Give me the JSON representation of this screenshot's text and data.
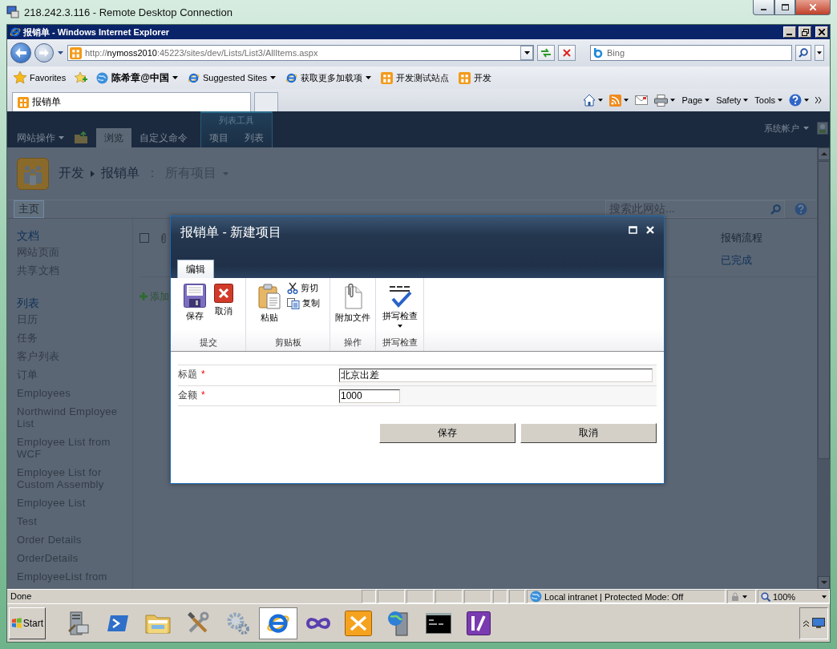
{
  "rdp_window": {
    "title": "218.242.3.116 - Remote Desktop Connection"
  },
  "browser": {
    "title": "报销单 - Windows Internet Explorer",
    "address": {
      "scheme": "http://",
      "host": "nymoss2010",
      "path": ":45223/sites/dev/Lists/List3/AllItems.aspx"
    },
    "search_placeholder": "Bing",
    "favorites_label": "Favorites",
    "favorites": [
      {
        "label": "陈希章@中国",
        "kind": "globe",
        "dropdown": true,
        "emphasized": true
      },
      {
        "label": "Suggested Sites",
        "kind": "ie",
        "dropdown": true,
        "emphasized": false
      },
      {
        "label": "获取更多加载项",
        "kind": "ie",
        "dropdown": true,
        "emphasized": false
      },
      {
        "label": "开发测试站点",
        "kind": "site",
        "dropdown": false,
        "emphasized": false
      },
      {
        "label": "开发",
        "kind": "site",
        "dropdown": false,
        "emphasized": false
      }
    ],
    "tabs": [
      {
        "label": "报销单",
        "selected": true
      }
    ],
    "commands": [
      {
        "kind": "home",
        "dropdown": true
      },
      {
        "kind": "feed",
        "dropdown": true
      },
      {
        "kind": "mail",
        "dropdown": false
      },
      {
        "kind": "print",
        "dropdown": true
      },
      {
        "label": "Page",
        "dropdown": true
      },
      {
        "label": "Safety",
        "dropdown": true
      },
      {
        "label": "Tools",
        "dropdown": true
      },
      {
        "kind": "help",
        "dropdown": true
      }
    ]
  },
  "sharepoint": {
    "top_bar": {
      "site_actions": "网站操作",
      "tabs": [
        {
          "label": "浏览",
          "selected": true
        },
        {
          "label": "自定义命令",
          "selected": false
        }
      ],
      "context_group": {
        "title": "列表工具",
        "tabs": [
          {
            "label": "项目",
            "selected": false
          },
          {
            "label": "列表",
            "selected": false
          }
        ]
      },
      "user": "系统帐户"
    },
    "breadcrumb": {
      "site": "开发",
      "list": "报销单",
      "separator": "：",
      "view": "所有项目"
    },
    "nav": {
      "tabs": [
        {
          "label": "主页",
          "selected": true
        }
      ],
      "search_placeholder": "搜索此网站..."
    },
    "quick_launch": [
      {
        "heading": "文档",
        "items": [
          "网站页面",
          "共享文档"
        ]
      },
      {
        "heading": "列表",
        "items": [
          "日历",
          "任务",
          "客户列表",
          "订单",
          "Employees",
          "Northwind Employee List",
          "Employee List from WCF",
          "Employee List for Custom Assembly",
          "Employee List",
          "Test",
          "Order Details",
          "OrderDetails",
          "EmployeeList from"
        ]
      }
    ],
    "list": {
      "select_all": {
        "checked": false
      },
      "columns": [
        {
          "header": "报销流程",
          "value": "已完成"
        }
      ],
      "add_label": "添加"
    }
  },
  "dialog": {
    "title": "报销单 - 新建项目",
    "ribbon_tabs": [
      {
        "label": "编辑",
        "selected": true
      }
    ],
    "ribbon_groups": [
      {
        "label": "提交",
        "buttons": [
          {
            "label": "保存",
            "kind": "save",
            "dropdown": false
          },
          {
            "label": "取消",
            "kind": "cancel",
            "dropdown": false
          }
        ]
      },
      {
        "label": "剪贴板",
        "buttons": [
          {
            "label": "粘贴",
            "kind": "paste",
            "dropdown": false
          },
          {
            "label": "剪切",
            "kind": "cut",
            "dropdown": false
          },
          {
            "label": "复制",
            "kind": "copy",
            "dropdown": false
          }
        ]
      },
      {
        "label": "操作",
        "buttons": [
          {
            "label": "附加文件",
            "kind": "attach",
            "dropdown": false
          }
        ]
      },
      {
        "label": "拼写检查",
        "buttons": [
          {
            "label": "拼写检查",
            "kind": "spelling",
            "dropdown": true
          }
        ]
      }
    ],
    "fields": [
      {
        "label": "标题",
        "required_mark": "*",
        "value": "北京出差",
        "kind": "text"
      },
      {
        "label": "金额",
        "required_mark": "*",
        "value": "1000",
        "kind": "number"
      }
    ],
    "buttons": [
      "保存",
      "取消"
    ]
  },
  "status_bar": {
    "text": "Done",
    "zone": "Local intranet | Protected Mode: Off",
    "zoom": "100%"
  },
  "taskbar": {
    "start": "Start",
    "apps": [
      {
        "kind": "server",
        "selected": false
      },
      {
        "kind": "prompt",
        "selected": false
      },
      {
        "kind": "folder",
        "selected": false
      },
      {
        "kind": "tools",
        "selected": false
      },
      {
        "kind": "gears",
        "selected": false
      },
      {
        "kind": "browser",
        "selected": true
      },
      {
        "kind": "infinity",
        "selected": false
      },
      {
        "kind": "tools-tile",
        "selected": false
      },
      {
        "kind": "server-globe",
        "selected": false
      },
      {
        "kind": "console",
        "selected": false
      },
      {
        "kind": "app",
        "selected": false
      }
    ]
  }
}
